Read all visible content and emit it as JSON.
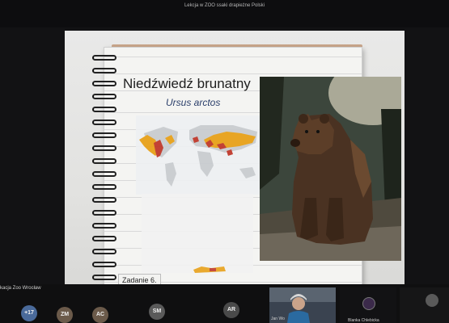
{
  "meeting": {
    "title": "Lekcja w ZOO ssaki drapieżne Polski"
  },
  "slide": {
    "title": "Niedźwiedź brunatny",
    "latin_name": "Ursus arctos",
    "task_label": "Zadanie 6."
  },
  "participants": {
    "organization_label": "kacja Zoo Wrocław",
    "overflow_count": "+17",
    "avatars": [
      {
        "initials": "ZM",
        "color": "#6b5a4a"
      },
      {
        "initials": "AC",
        "color": "#6b5a4a"
      },
      {
        "initials": "SM",
        "color": "#5a5a5a"
      },
      {
        "initials": "AR",
        "color": "#4a4a4a"
      }
    ],
    "overflow_color": "#4a6a9a",
    "video_tile_name": "Jan Wo",
    "tile_name_2": "Blanka Chlebicka"
  }
}
